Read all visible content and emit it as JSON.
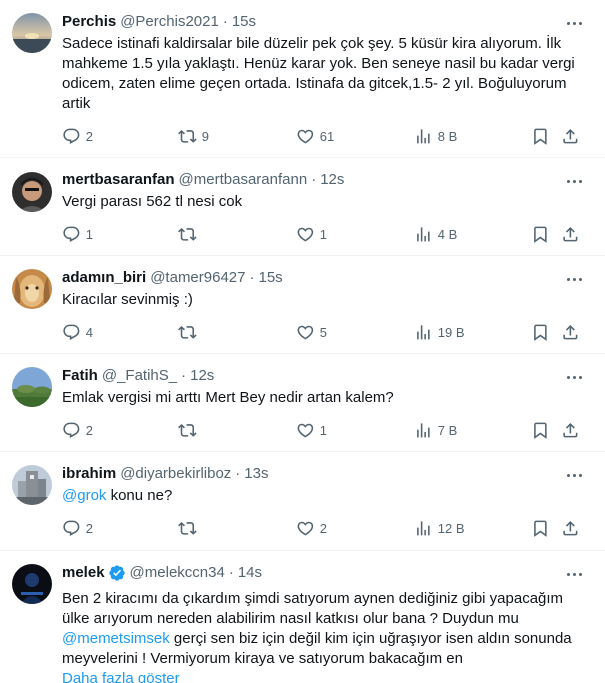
{
  "tweets": [
    {
      "name": "Perchis",
      "handle": "@Perchis2021",
      "separator": "·",
      "time": "15s",
      "text": "Sadece istinafi kaldirsalar bile düzelir pek çok şey. 5 küsür kira alıyorum. İlk mahkeme 1.5 yıla yaklaştı. Henüz karar yok. Ben seneye nasil bu kadar vergi odicem, zaten elime geçen ortada. Istinafa da gitcek,1.5- 2 yıl. Boğuluyorum artik",
      "replies": "2",
      "reposts": "9",
      "likes": "61",
      "views": "8 B"
    },
    {
      "name": "mertbasaranfan",
      "handle": "@mertbasaranfann",
      "separator": "·",
      "time": "12s",
      "text": "Vergi parası 562 tl nesi cok",
      "replies": "1",
      "reposts": "",
      "likes": "1",
      "views": "4 B"
    },
    {
      "name": "adamın_biri",
      "handle": "@tamer96427",
      "separator": "·",
      "time": "15s",
      "text": "Kiracılar sevinmiş :)",
      "replies": "4",
      "reposts": "",
      "likes": "5",
      "views": "19 B"
    },
    {
      "name": "Fatih",
      "handle": "@_FatihS_",
      "separator": "·",
      "time": "12s",
      "text": "Emlak vergisi mi arttı Mert Bey nedir artan kalem?",
      "replies": "2",
      "reposts": "",
      "likes": "1",
      "views": "7 B"
    },
    {
      "name": "ibrahim",
      "handle": "@diyarbekirliboz",
      "separator": "·",
      "time": "13s",
      "mention": "@grok",
      "text_after_mention": " konu ne?",
      "replies": "2",
      "reposts": "",
      "likes": "2",
      "views": "12 B"
    },
    {
      "name": "melek",
      "handle": "@melekccn34",
      "separator": "·",
      "time": "14s",
      "text_before_mention": "Ben 2 kiracımı da çıkardım şimdi satıyorum aynen dediğiniz gibi yapacağım ülke arıyorum nereden alabilirim nasıl katkısı olur bana ? Duydun mu ",
      "mention": "@memetsimsek",
      "text_after_mention": " gerçi sen biz için değil kim için uğraşıyor isen aldın sonunda meyvelerini ! Vermiyorum kiraya ve satıyorum bakacağım en",
      "show_more": "Daha fazla göster"
    }
  ],
  "colors": {
    "text": "#0f1419",
    "muted": "#536471",
    "accent": "#1d9bf0",
    "border": "#eff3f4"
  },
  "icons": [
    "reply-icon",
    "repost-icon",
    "like-icon",
    "views-icon",
    "bookmark-icon",
    "share-icon",
    "more-icon",
    "verified-badge-icon"
  ]
}
